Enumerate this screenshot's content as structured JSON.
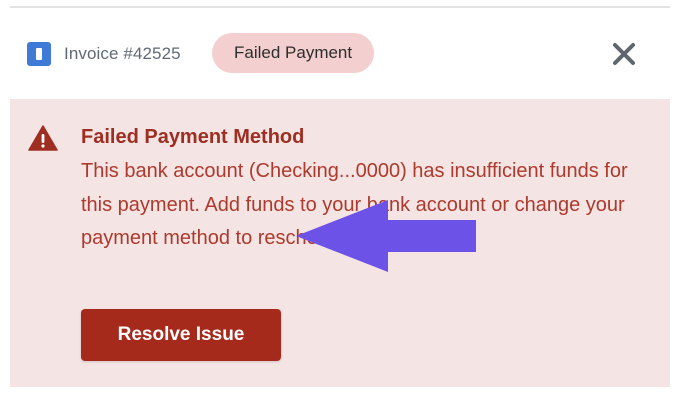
{
  "header": {
    "invoice_label": "Invoice #42525",
    "status_badge": "Failed Payment",
    "doc_icon": "document-icon",
    "close_icon": "close-icon"
  },
  "alert": {
    "icon": "warning-icon",
    "title": "Failed Payment Method",
    "body": "This bank account (Checking...0000) has insufficient funds for this payment. Add funds to your bank account or change your payment method to reschedule the payment.",
    "action_label": "Resolve Issue"
  },
  "annotation": {
    "icon": "arrow-left-icon",
    "color": "#6d52e8"
  },
  "colors": {
    "alert_background": "#f4e4e4",
    "alert_text": "#ad3a2c",
    "button_background": "#a52a1c",
    "badge_background": "#f3d0cf",
    "doc_icon": "#3f7bd6"
  }
}
